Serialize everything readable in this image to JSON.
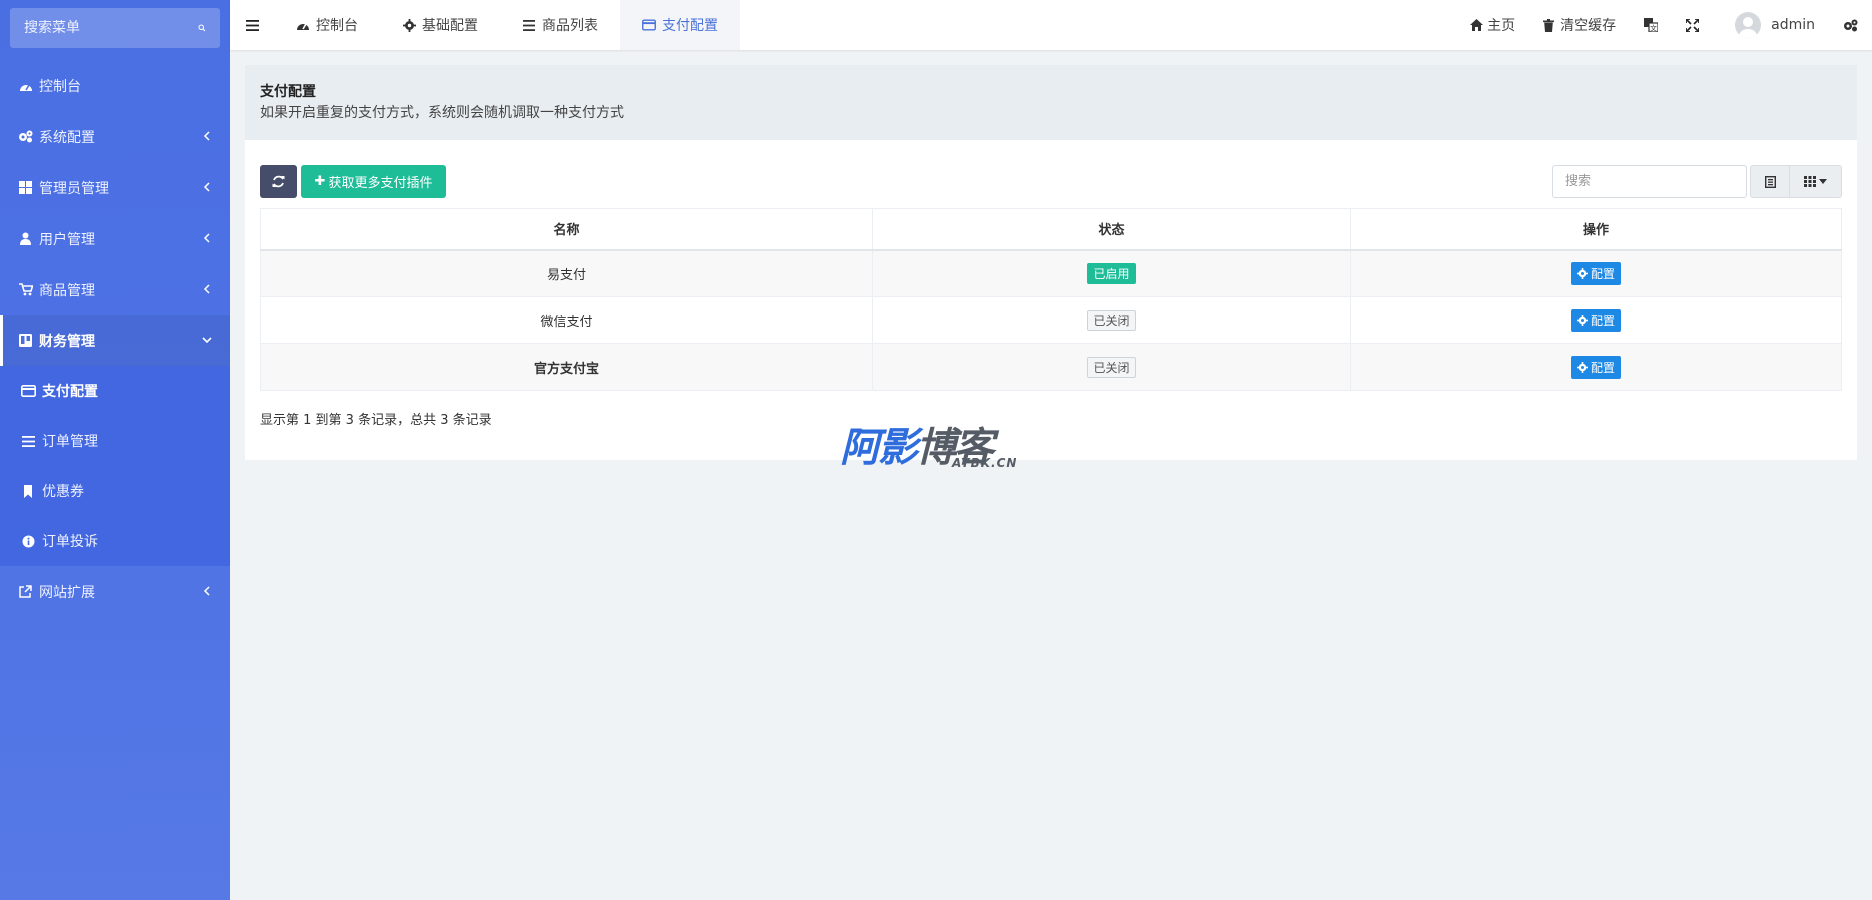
{
  "sidebar": {
    "search_placeholder": "搜索菜单",
    "items": [
      {
        "label": "控制台"
      },
      {
        "label": "系统配置"
      },
      {
        "label": "管理员管理"
      },
      {
        "label": "用户管理"
      },
      {
        "label": "商品管理"
      },
      {
        "label": "财务管理"
      },
      {
        "label": "网站扩展"
      }
    ],
    "submenu": [
      {
        "label": "支付配置"
      },
      {
        "label": "订单管理"
      },
      {
        "label": "优惠券"
      },
      {
        "label": "订单投诉"
      }
    ]
  },
  "topbar": {
    "tabs": [
      {
        "label": "控制台"
      },
      {
        "label": "基础配置"
      },
      {
        "label": "商品列表"
      },
      {
        "label": "支付配置"
      }
    ],
    "home_label": "主页",
    "clear_cache_label": "清空缓存",
    "user_name": "admin"
  },
  "panel": {
    "title": "支付配置",
    "description": "如果开启重复的支付方式，系统则会随机调取一种支付方式"
  },
  "toolbar": {
    "more_plugins_label": "获取更多支付插件",
    "search_placeholder": "搜索"
  },
  "table": {
    "headers": [
      "名称",
      "状态",
      "操作"
    ],
    "rows": [
      {
        "name": "易支付",
        "status": "已启用",
        "action": "配置"
      },
      {
        "name": "微信支付",
        "status": "已关闭",
        "action": "配置"
      },
      {
        "name": "官方支付宝",
        "status": "已关闭",
        "action": "配置"
      }
    ]
  },
  "pager_text": "显示第 1 到第 3 条记录，总共 3 条记录",
  "watermark": {
    "cn_a": "阿影",
    "cn_b": "博客",
    "en": "AYBK.CN"
  },
  "colors": {
    "sidebar": "#4a6fe3",
    "success": "#1fbc98",
    "primary": "#1e88e5",
    "dark": "#454d6a"
  }
}
